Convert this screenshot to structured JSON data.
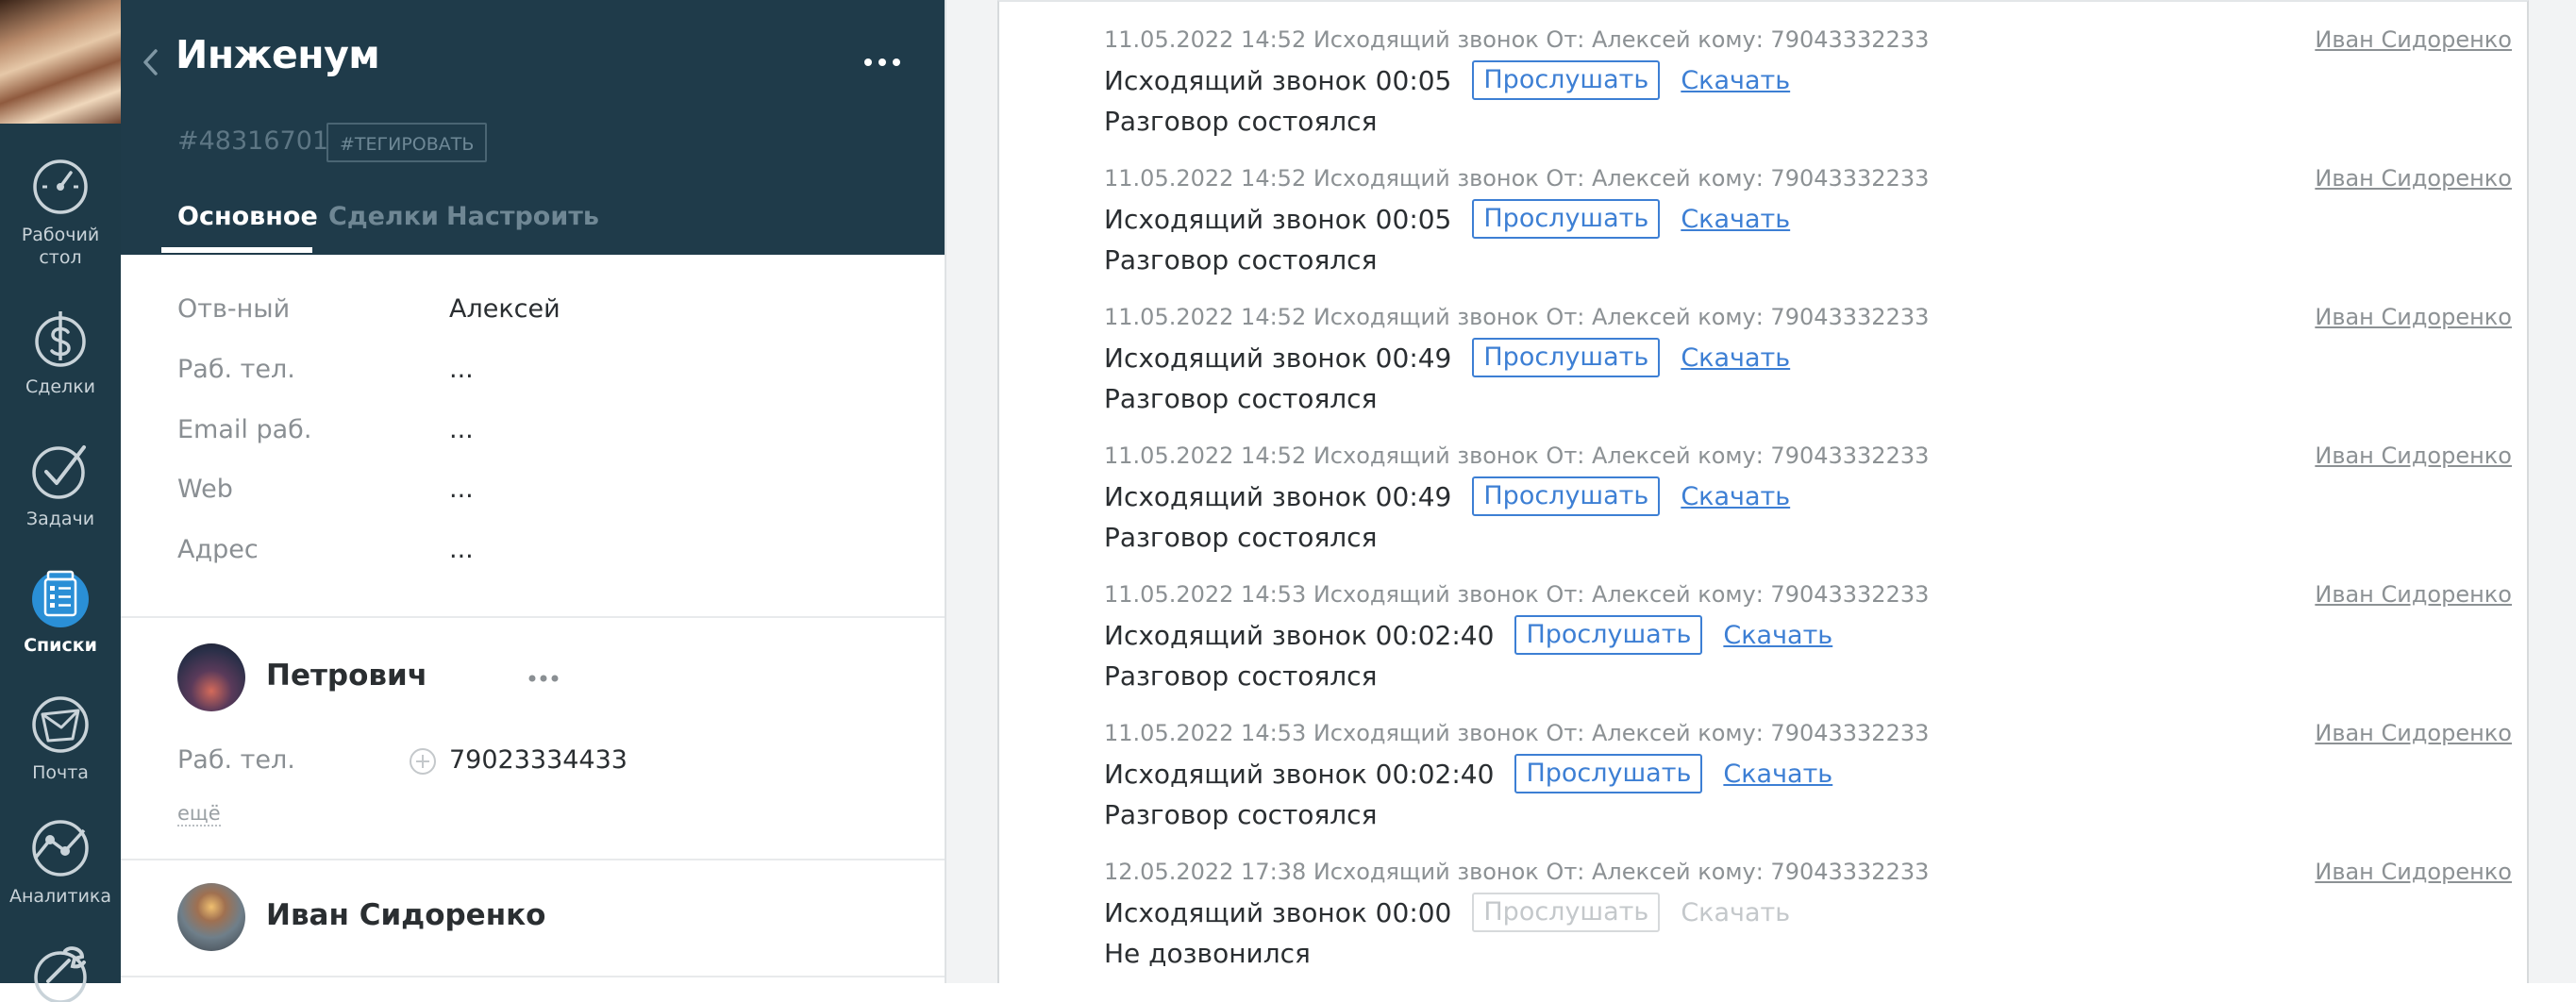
{
  "nav": {
    "items": [
      {
        "label": "Рабочий стол",
        "icon": "dashboard-gauge-icon"
      },
      {
        "label": "Сделки",
        "icon": "dollar-icon"
      },
      {
        "label": "Задачи",
        "icon": "checkmark-icon"
      },
      {
        "label": "Списки",
        "icon": "lists-icon",
        "active": true
      },
      {
        "label": "Почта",
        "icon": "mail-icon"
      },
      {
        "label": "Аналитика",
        "icon": "analytics-icon"
      },
      {
        "label": "",
        "icon": "wrench-icon"
      }
    ]
  },
  "card": {
    "title": "Инженум",
    "id": "#48316701",
    "tag_label": "#ТЕГИРОВАТЬ",
    "tabs": [
      {
        "label": "Основное",
        "active": true
      },
      {
        "label": "Сделки"
      },
      {
        "label": "Настроить"
      }
    ],
    "fields": [
      {
        "label": "Отв-ный",
        "value": "Алексей"
      },
      {
        "label": "Раб. тел.",
        "value": "..."
      },
      {
        "label": "Email раб.",
        "value": "..."
      },
      {
        "label": "Web",
        "value": "..."
      },
      {
        "label": "Адрес",
        "value": "..."
      }
    ],
    "contacts": [
      {
        "name": "Петрович",
        "phone_label": "Раб. тел.",
        "phone": "79023334433",
        "more": "ещё"
      },
      {
        "name": "Иван Сидоренко"
      }
    ]
  },
  "feed": {
    "entries": [
      {
        "meta": "11.05.2022 14:52 Исходящий звонок От: Алексей кому: 79043332233",
        "author": "Иван Сидоренко",
        "title": "Исходящий звонок 00:05",
        "listen": "Прослушать",
        "download": "Скачать",
        "status": "Разговор состоялся"
      },
      {
        "meta": "11.05.2022 14:52 Исходящий звонок От: Алексей кому: 79043332233",
        "author": "Иван Сидоренко",
        "title": "Исходящий звонок 00:05",
        "listen": "Прослушать",
        "download": "Скачать",
        "status": "Разговор состоялся"
      },
      {
        "meta": "11.05.2022 14:52 Исходящий звонок От: Алексей кому: 79043332233",
        "author": "Иван Сидоренко",
        "title": "Исходящий звонок 00:49",
        "listen": "Прослушать",
        "download": "Скачать",
        "status": "Разговор состоялся"
      },
      {
        "meta": "11.05.2022 14:52 Исходящий звонок От: Алексей кому: 79043332233",
        "author": "Иван Сидоренко",
        "title": "Исходящий звонок 00:49",
        "listen": "Прослушать",
        "download": "Скачать",
        "status": "Разговор состоялся"
      },
      {
        "meta": "11.05.2022 14:53 Исходящий звонок От: Алексей кому: 79043332233",
        "author": "Иван Сидоренко",
        "title": "Исходящий звонок 00:02:40",
        "listen": "Прослушать",
        "download": "Скачать",
        "status": "Разговор состоялся"
      },
      {
        "meta": "11.05.2022 14:53 Исходящий звонок От: Алексей кому: 79043332233",
        "author": "Иван Сидоренко",
        "title": "Исходящий звонок 00:02:40",
        "listen": "Прослушать",
        "download": "Скачать",
        "status": "Разговор состоялся"
      },
      {
        "meta": "12.05.2022 17:38 Исходящий звонок От: Алексей кому: 79043332233",
        "author": "Иван Сидоренко",
        "title": "Исходящий звонок 00:00",
        "listen": "Прослушать",
        "download": "Скачать",
        "status": "Не дозвонился",
        "disabled": true
      }
    ]
  },
  "colors": {
    "nav_bg": "#1e3a48",
    "header_bg": "#1f3b4a",
    "link": "#3d7fd4",
    "lists_accent": "#2a8fd6"
  }
}
